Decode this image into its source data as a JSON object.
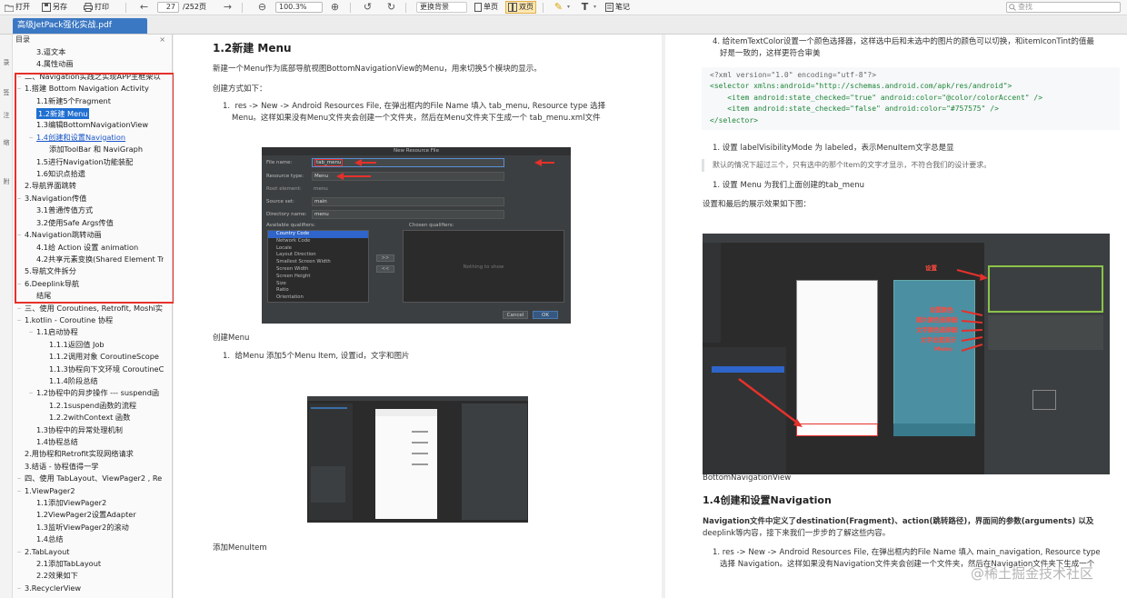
{
  "toolbar": {
    "open": "打开",
    "save_as": "另存",
    "print": "打印",
    "page_current": "27",
    "page_total": "/252页",
    "zoom": "100.3%",
    "background": "更换背景",
    "single_page": "单页",
    "double_page": "双页",
    "notes": "笔记",
    "search_placeholder": "查找"
  },
  "tab": {
    "title": "高级JetPack强化实战.pdf"
  },
  "left_strip": [
    "录",
    "签",
    "注",
    "缩",
    "附"
  ],
  "outline": {
    "header": "目录",
    "close": "×",
    "items": [
      {
        "label": "3.逼文本",
        "level": 2,
        "tw": ""
      },
      {
        "label": "4.属性动画",
        "level": 2,
        "tw": ""
      },
      {
        "label": "二、Navigation实践之实现APP主框架以",
        "level": 1,
        "tw": "−"
      },
      {
        "label": "1.搭建 Bottom Navigation Activity",
        "level": 1,
        "tw": "−"
      },
      {
        "label": "1.1新建5个Fragment",
        "level": 2,
        "tw": ""
      },
      {
        "label": "1.2新建 Menu",
        "level": 2,
        "tw": "",
        "selected": true
      },
      {
        "label": "1.3编辑BottomNavigationView",
        "level": 2,
        "tw": ""
      },
      {
        "label": "1.4创建和设置Navigation",
        "level": 2,
        "tw": "−",
        "link": true
      },
      {
        "label": "添加ToolBar 和 NaviGraph",
        "level": 3,
        "tw": ""
      },
      {
        "label": "1.5进行Navigation功能装配",
        "level": 2,
        "tw": ""
      },
      {
        "label": "1.6知识点拾遗",
        "level": 2,
        "tw": ""
      },
      {
        "label": "2.导航界面跳转",
        "level": 1,
        "tw": ""
      },
      {
        "label": "3.Navigation传值",
        "level": 1,
        "tw": "−"
      },
      {
        "label": "3.1普通传值方式",
        "level": 2,
        "tw": ""
      },
      {
        "label": "3.2使用Safe Args传值",
        "level": 2,
        "tw": ""
      },
      {
        "label": "4.Navigation跳转动画",
        "level": 1,
        "tw": "−"
      },
      {
        "label": "4.1给 Action 设置 animation",
        "level": 2,
        "tw": ""
      },
      {
        "label": "4.2共享元素变换(Shared Element Tr",
        "level": 2,
        "tw": ""
      },
      {
        "label": "5.导航文件拆分",
        "level": 1,
        "tw": ""
      },
      {
        "label": "6.Deeplink导航",
        "level": 1,
        "tw": "−"
      },
      {
        "label": "结尾",
        "level": 2,
        "tw": ""
      },
      {
        "label": "三、使用 Coroutines, Retrofit, Moshi实",
        "level": 1,
        "tw": "−"
      },
      {
        "label": "1.kotlin - Coroutine 协程",
        "level": 1,
        "tw": "−"
      },
      {
        "label": "1.1启动协程",
        "level": 2,
        "tw": "−"
      },
      {
        "label": "1.1.1返回值 Job",
        "level": 3,
        "tw": ""
      },
      {
        "label": "1.1.2调用对象 CoroutineScope",
        "level": 3,
        "tw": ""
      },
      {
        "label": "1.1.3协程向下文环境 CoroutineC",
        "level": 3,
        "tw": ""
      },
      {
        "label": "1.1.4阶段总结",
        "level": 3,
        "tw": ""
      },
      {
        "label": "1.2协程中的异步操作 --- suspend函",
        "level": 2,
        "tw": "−"
      },
      {
        "label": "1.2.1suspend函数的流程",
        "level": 3,
        "tw": ""
      },
      {
        "label": "1.2.2withContext 函数",
        "level": 3,
        "tw": ""
      },
      {
        "label": "1.3协程中的异常处理机制",
        "level": 2,
        "tw": ""
      },
      {
        "label": "1.4协程总结",
        "level": 2,
        "tw": ""
      },
      {
        "label": "2.用协程和Retrofit实现网络请求",
        "level": 1,
        "tw": ""
      },
      {
        "label": "3.结语 - 协程值得一学",
        "level": 1,
        "tw": ""
      },
      {
        "label": "四、使用 TabLayout、ViewPager2 , Re",
        "level": 1,
        "tw": "−"
      },
      {
        "label": "1.ViewPager2",
        "level": 1,
        "tw": "−"
      },
      {
        "label": "1.1添加ViewPager2",
        "level": 2,
        "tw": ""
      },
      {
        "label": "1.2ViewPager2设置Adapter",
        "level": 2,
        "tw": ""
      },
      {
        "label": "1.3监听ViewPager2的滚动",
        "level": 2,
        "tw": ""
      },
      {
        "label": "1.4总结",
        "level": 2,
        "tw": ""
      },
      {
        "label": "2.TabLayout",
        "level": 1,
        "tw": "−"
      },
      {
        "label": "2.1添加TabLayout",
        "level": 2,
        "tw": ""
      },
      {
        "label": "2.2效果如下",
        "level": 2,
        "tw": ""
      },
      {
        "label": "3.RecyclerView",
        "level": 1,
        "tw": "−"
      }
    ]
  },
  "page_left": {
    "heading": "1.2新建 Menu",
    "intro": "新建一个Menu作为底部导航视图BottomNavigationView的Menu，用来切换5个模块的显示。",
    "method": "创建方式如下：",
    "step1_a": "res -> New -> Android Resources File, 在弹出框内的File Name 填入 tab_menu, Resource type 选择",
    "step1_b": "Menu。这样如果没有Menu文件夹会创建一个文件夹，然后在Menu文件夹下生成一个 tab_menu.xml文件",
    "caption1": "创建Menu",
    "step2": "给Menu 添加5个Menu Item, 设置id，文字和图片",
    "caption2": "添加MenuItem",
    "dialog": {
      "title": "New Resource File",
      "file_name_label": "File name:",
      "file_name_value": "tab_menu",
      "resource_type_label": "Resource type:",
      "resource_type_value": "Menu",
      "root_element_label": "Root element:",
      "root_element_value": "menu",
      "source_set_label": "Source set:",
      "source_set_value": "main",
      "directory_label": "Directory name:",
      "directory_value": "menu",
      "available_label": "Available qualifiers:",
      "chosen_label": "Chosen qualifiers:",
      "qualifiers": [
        "Country Code",
        "Network Code",
        "Locale",
        "Layout Direction",
        "Smallest Screen Width",
        "Screen Width",
        "Screen Height",
        "Size",
        "Ratio",
        "Orientation"
      ],
      "nothing_to_show": "Nothing to show",
      "cancel": "Cancel",
      "ok": "OK"
    }
  },
  "page_right": {
    "step4_a": "4. 给itemTextColor设置一个颜色选择器，这样选中后和未选中的图片的颜色可以切换，和itemIconTint的值最",
    "step4_b": "好是一致的，这样更符合审美",
    "code": [
      {
        "t": "<?xml version=\"1.0\" encoding=\"utf-8\"?>",
        "k": "plain"
      },
      {
        "t": "<selector xmlns:android=\"http://schemas.android.com/apk/res/android\">",
        "k": "tag"
      },
      {
        "t": "    <item android:state_checked=\"true\" android:color=\"@color/colorAccent\" />",
        "k": "tag"
      },
      {
        "t": "    <item android:state_checked=\"false\" android:color=\"#757575\" />",
        "k": "tag"
      },
      {
        "t": "</selector>",
        "k": "tag"
      }
    ],
    "step1": "1. 设置 labelVisibilityMode 为 labeled，表示MenuItem文字总是显",
    "quote": "默认的情况下超过三个，只有选中的那个Item的文字才显示，不符合我们的设计要求。",
    "step2": "1. 设置 Menu 为我们上面创建的tab_menu",
    "final": "设置和最后的展示效果如下图：",
    "caption": "BottomNavigationView",
    "heading": "1.4创建和设置Navigation",
    "para_a": "Navigation文件中定义了destination(Fragment)、action(跳转路径)，界面间的参数(arguments) 以及",
    "para_b": "deeplink等内容，接下来我们一步步的了解这些内容。",
    "step3_a": "1. res -> New -> Android Resources File, 在弹出框内的File Name 填入 main_navigation, Resource type",
    "step3_b": "选择 Navigation。这样如果没有Navigation文件夹会创建一个文件夹，然后在Navigation文件夹下生成一个",
    "annotations": [
      "设置",
      "设置颜色",
      "图片颜色选择器",
      "文字颜色选择器",
      "文字总是显示",
      "Menu"
    ]
  },
  "watermark": "@稀土掘金技术社区",
  "colors": {
    "accent": "#3b78c3",
    "highlight_box": "#e6312b",
    "selection": "#1f6fd1"
  }
}
